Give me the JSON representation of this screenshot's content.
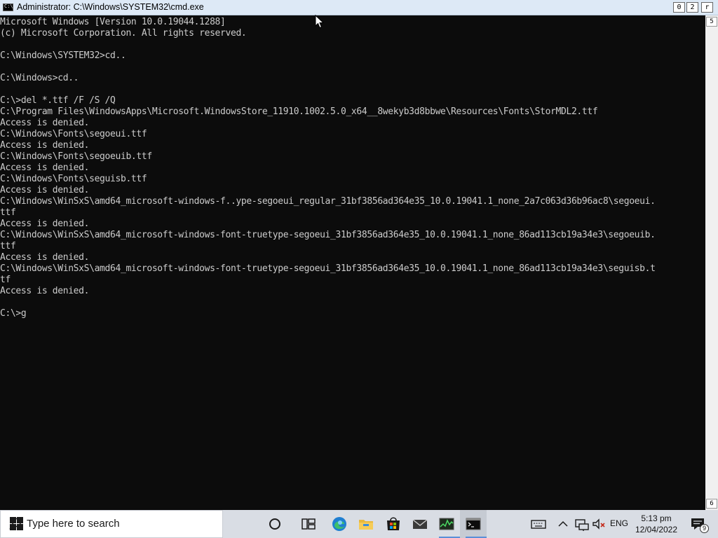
{
  "window": {
    "title": "Administrator: C:\\Windows\\SYSTEM32\\cmd.exe",
    "controls": [
      "0",
      "2",
      "r"
    ]
  },
  "console": {
    "output": "Microsoft Windows [Version 10.0.19044.1288]\n(c) Microsoft Corporation. All rights reserved.\n\nC:\\Windows\\SYSTEM32>cd..\n\nC:\\Windows>cd..\n\nC:\\>del *.ttf /F /S /Q\nC:\\Program Files\\WindowsApps\\Microsoft.WindowsStore_11910.1002.5.0_x64__8wekyb3d8bbwe\\Resources\\Fonts\\StorMDL2.ttf\nAccess is denied.\nC:\\Windows\\Fonts\\segoeui.ttf\nAccess is denied.\nC:\\Windows\\Fonts\\segoeuib.ttf\nAccess is denied.\nC:\\Windows\\Fonts\\seguisb.ttf\nAccess is denied.\nC:\\Windows\\WinSxS\\amd64_microsoft-windows-f..ype-segoeui_regular_31bf3856ad364e35_10.0.19041.1_none_2a7c063d36b96ac8\\segoeui.\nttf\nAccess is denied.\nC:\\Windows\\WinSxS\\amd64_microsoft-windows-font-truetype-segoeui_31bf3856ad364e35_10.0.19041.1_none_86ad113cb19a34e3\\segoeuib.\nttf\nAccess is denied.\nC:\\Windows\\WinSxS\\amd64_microsoft-windows-font-truetype-segoeui_31bf3856ad364e35_10.0.19041.1_none_86ad113cb19a34e3\\seguisb.t\ntf\nAccess is denied.\n\nC:\\>g"
  },
  "scrollbar": {
    "up_arrow": "5",
    "down_arrow": "6"
  },
  "taskbar": {
    "search_placeholder": "Type here to search",
    "language": "ENG",
    "time": "5:13 pm",
    "date": "12/04/2022",
    "notification_count": "9",
    "icons": [
      "windows-start-icon",
      "search-icon",
      "cortana-icon",
      "task-view-icon",
      "edge-icon",
      "file-explorer-icon",
      "store-icon",
      "mail-icon",
      "resource-monitor-icon",
      "cmd-icon"
    ]
  }
}
